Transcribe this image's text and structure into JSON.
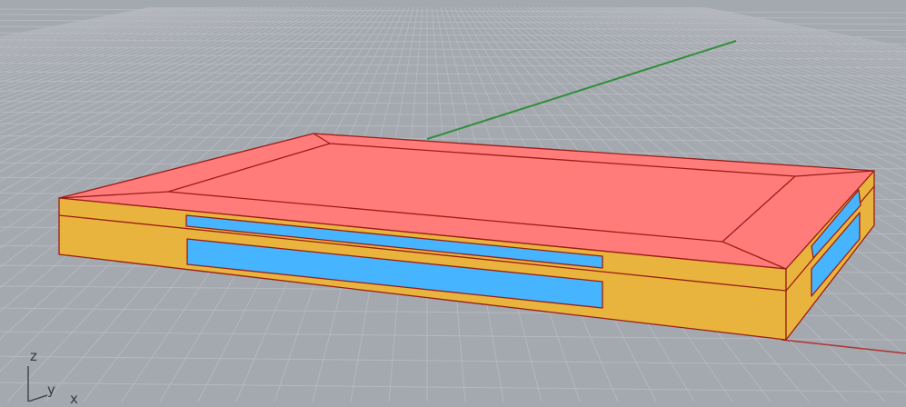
{
  "viewport": {
    "background_color": "#a4a8af",
    "grid_color": "#b6b9be",
    "x_axis_color": "#b3322d",
    "y_axis_color": "#2f8f3a"
  },
  "model": {
    "top_face_color": "#ff7c7a",
    "side_face_color": "#e9b43d",
    "slot_color": "#46b4ff",
    "edge_color": "#9a1e16"
  },
  "axis_indicator": {
    "z_label": "z",
    "y_label": "y",
    "x_label": "x"
  }
}
